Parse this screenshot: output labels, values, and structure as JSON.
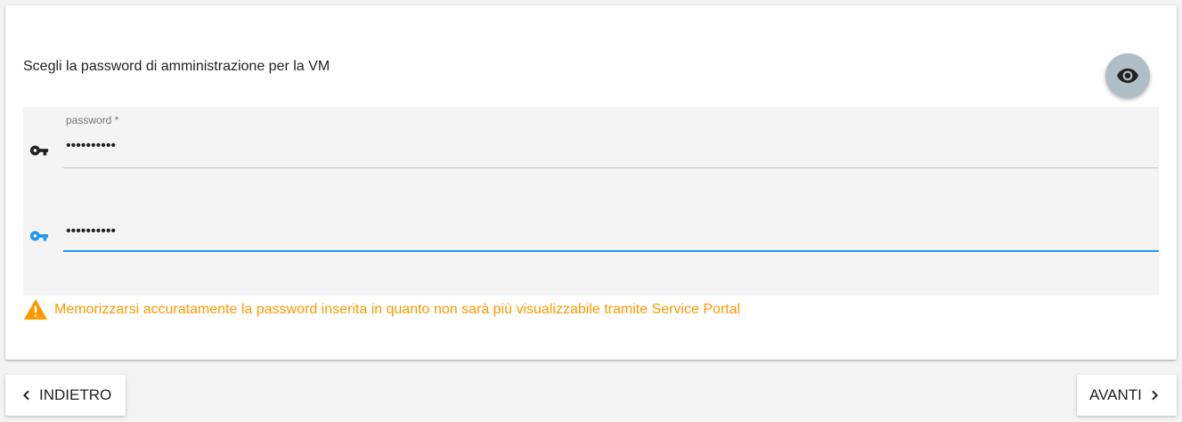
{
  "form": {
    "title": "Scegli la password di amministrazione per la VM",
    "password_label": "password *",
    "password_value": "••••••••••",
    "confirm_value": "••••••••••",
    "toggle_visibility_icon": "eye-icon",
    "field_icon": "key-icon"
  },
  "warning": {
    "icon": "warning-triangle-icon",
    "text": "Memorizzarsi accuratamente la password inserita in quanto non sarà più visualizzabile tramite Service Portal",
    "color": "#ff9800"
  },
  "navigation": {
    "back_label": "INDIETRO",
    "next_label": "AVANTI"
  },
  "colors": {
    "accent": "#2196f3",
    "eye_button_bg": "#b0bec5",
    "warning": "#ff9800"
  }
}
